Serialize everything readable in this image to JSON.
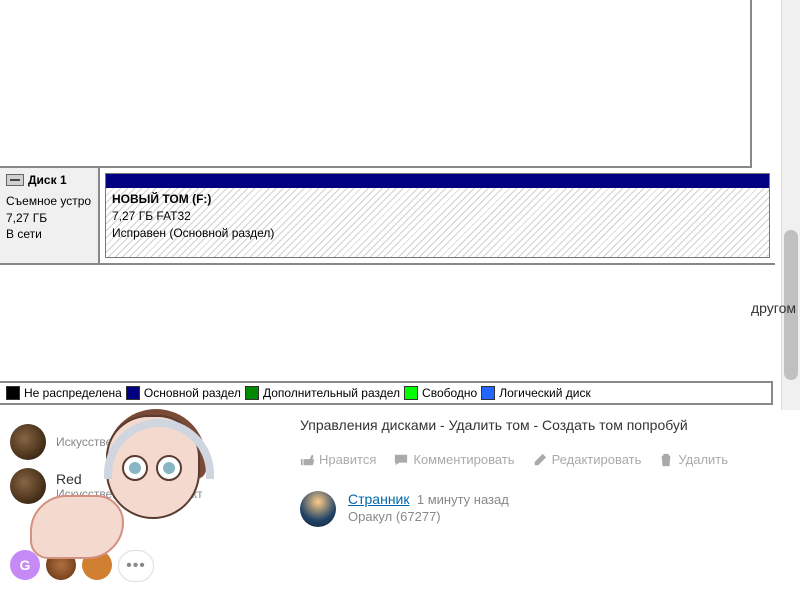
{
  "disk_mgmt": {
    "disk": {
      "label": "Диск 1",
      "type": "Съемное устро",
      "size": "7,27 ГБ",
      "state": "В сети"
    },
    "volume": {
      "name": "НОВЫЙ ТОМ  (F:)",
      "fs_line": "7,27 ГБ FAT32",
      "status": "Исправен (Основной раздел)"
    },
    "legend": {
      "unalloc": "Не распределена",
      "primary": "Основной раздел",
      "extended": "Дополнительный раздел",
      "free": "Свободно",
      "logical": "Логический диск"
    }
  },
  "right_text": "другом",
  "sidebar": {
    "top_sub": "Искусственный Интеллект",
    "user1_name": "Red",
    "user1_sub": "Искусственный Интеллект",
    "chip_g": "G"
  },
  "answer": {
    "body": "Управления дисками - Удалить том - Создать том попробуй",
    "actions": {
      "like": "Нравится",
      "comment": "Комментировать",
      "edit": "Редактировать",
      "delete": "Удалить"
    }
  },
  "comment": {
    "user": "Странник",
    "time": "1 минуту назад",
    "rank": "Оракул (67277)"
  }
}
